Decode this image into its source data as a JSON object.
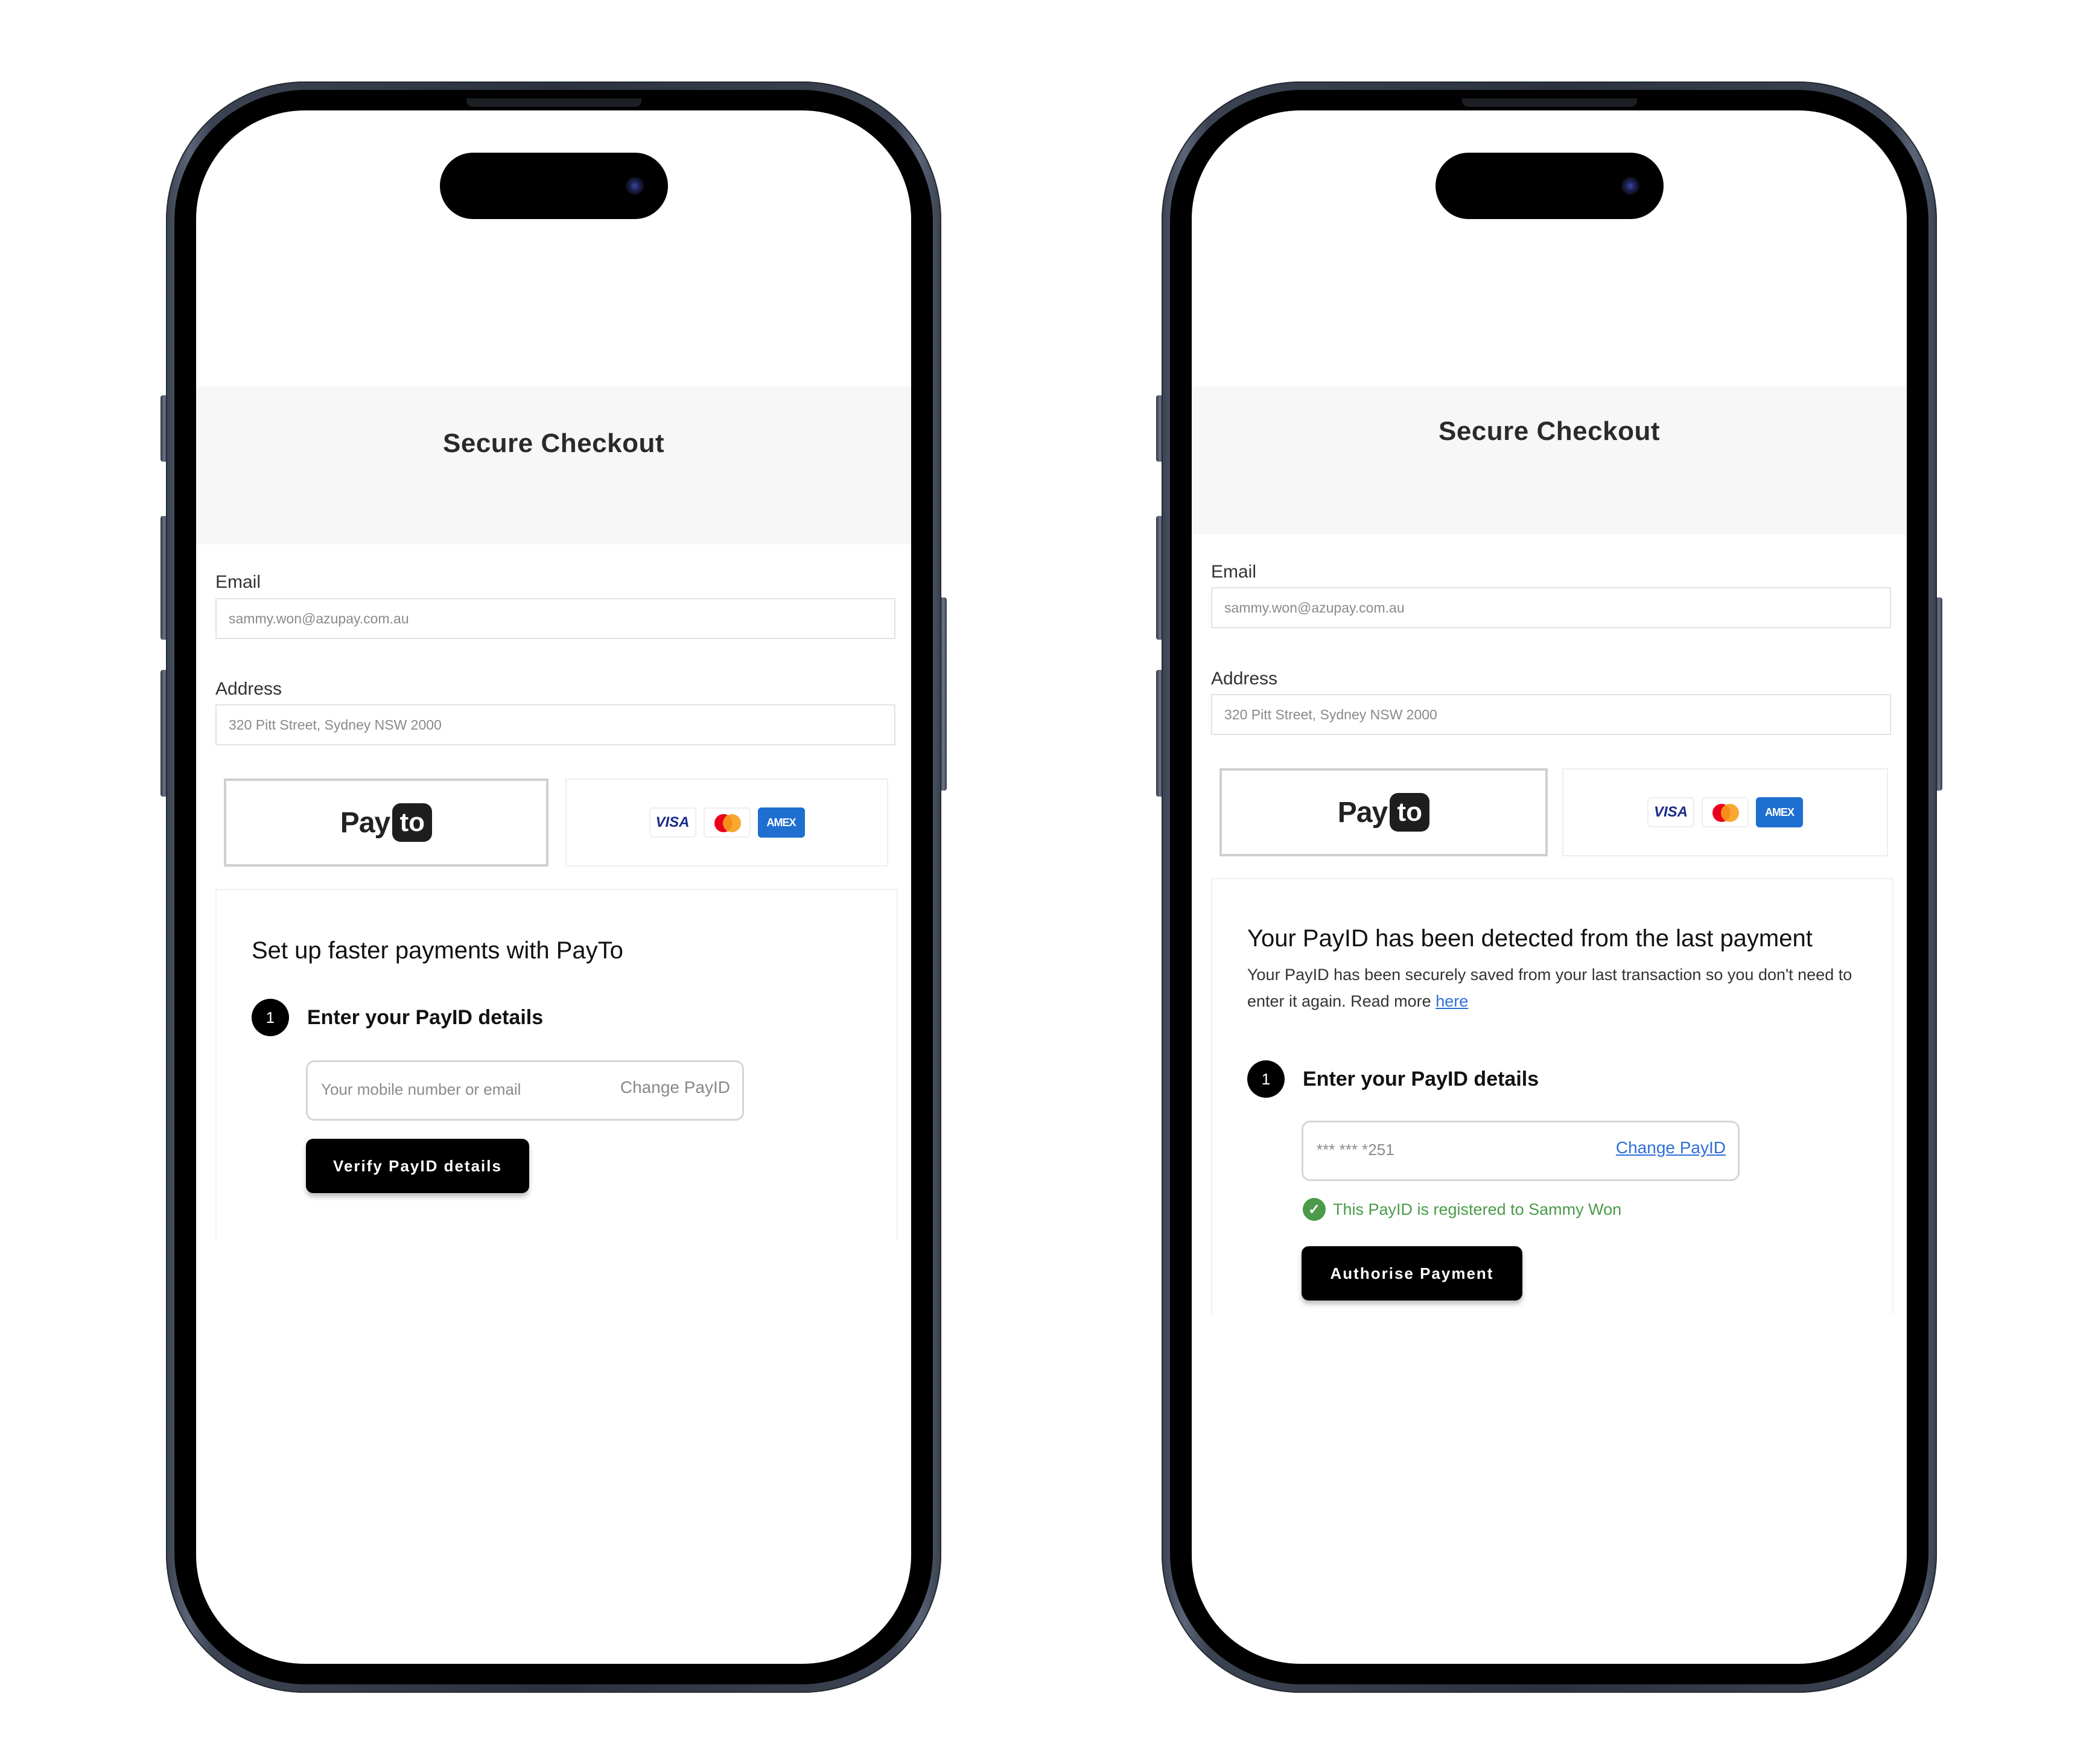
{
  "screens": [
    {
      "id": "left",
      "header": {
        "title": "Secure Checkout"
      },
      "form": {
        "email_label": "Email",
        "email_value": "sammy.won@azupay.com.au",
        "address_label": "Address",
        "address_value": "320 Pitt Street, Sydney NSW 2000"
      },
      "payment_methods": {
        "payto": {
          "pay": "Pay",
          "to": "to",
          "selected": true
        },
        "cards": [
          "VISA",
          "Mastercard",
          "AMEX"
        ]
      },
      "panel": {
        "title": "Set up faster payments with PayTo",
        "step_number": "1",
        "step_label": "Enter your PayID details",
        "input_placeholder": "Your mobile number or email",
        "change_label": "Change PayID",
        "button_label": "Verify PayID details"
      }
    },
    {
      "id": "right",
      "header": {
        "title": "Secure Checkout"
      },
      "form": {
        "email_label": "Email",
        "email_value": "sammy.won@azupay.com.au",
        "address_label": "Address",
        "address_value": "320 Pitt Street, Sydney NSW 2000"
      },
      "payment_methods": {
        "payto": {
          "pay": "Pay",
          "to": "to",
          "selected": true
        },
        "cards": [
          "VISA",
          "Mastercard",
          "AMEX"
        ]
      },
      "panel": {
        "title": "Your PayID has been detected from the last payment",
        "subtitle": "Your PayID has been securely saved from your last transaction so you don't need to enter it again. Read more",
        "subtitle_link": "here",
        "step_number": "1",
        "step_label": "Enter your PayID details",
        "input_value": "*** *** *251",
        "change_label": "Change PayID",
        "verified_text": "This PayID is registered to Sammy Won",
        "button_label": "Authorise Payment"
      }
    }
  ],
  "colors": {
    "header_bg": "#f7f7f7",
    "button_bg": "#000000",
    "link": "#2f6fd6",
    "success": "#4a9a4a",
    "amex": "#1f6fd0",
    "visa": "#1a2a8a"
  }
}
